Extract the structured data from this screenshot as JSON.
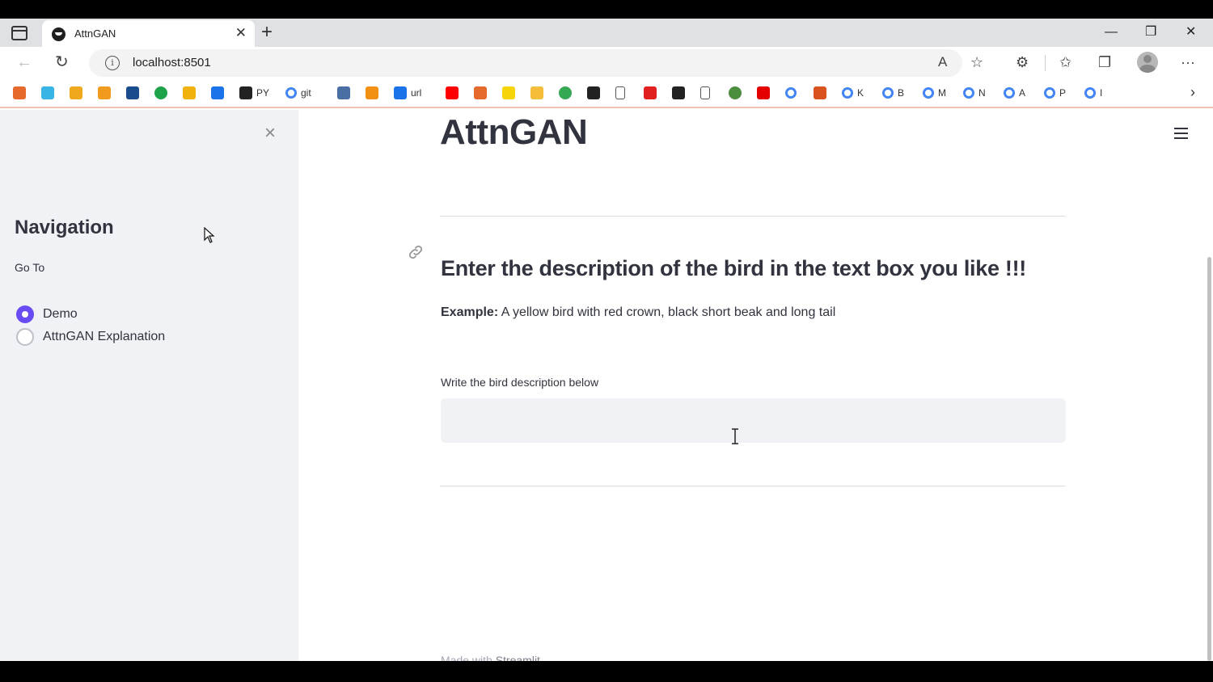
{
  "browser": {
    "tab_title": "AttnGAN",
    "tab_close": "✕",
    "new_tab": "+",
    "window_controls": {
      "minimize": "—",
      "restore": "❐",
      "close": "✕"
    },
    "url": "localhost:8501",
    "bookmarks": [
      {
        "icon": "squares-icon",
        "color": "#e8692c",
        "text": ""
      },
      {
        "icon": "swirl-icon",
        "color": "#37b5e5",
        "text": ""
      },
      {
        "icon": "badge-icon",
        "color": "#f0a81e",
        "text": ""
      },
      {
        "icon": "bars-icon",
        "color": "#f09a1e",
        "text": ""
      },
      {
        "icon": "ieee-icon",
        "color": "#1a4b8c",
        "text": ""
      },
      {
        "icon": "green-circle-icon",
        "color": "#1fa34a",
        "text": ""
      },
      {
        "icon": "pencil-icon",
        "color": "#f2b20e",
        "text": ""
      },
      {
        "icon": "drive-icon",
        "color": "#1a73e8",
        "text": ""
      },
      {
        "icon": "github-icon",
        "color": "#222222",
        "text": "PY"
      },
      {
        "icon": "google-icon",
        "color": "#4285f4",
        "text": "git"
      },
      {
        "icon": "layers-icon",
        "color": "#4a6fa5",
        "text": ""
      },
      {
        "icon": "pma-icon",
        "color": "#f29111",
        "text": ""
      },
      {
        "icon": "arc-icon",
        "color": "#1a73e8",
        "text": "url"
      },
      {
        "icon": "youtube-icon",
        "color": "#ff0000",
        "text": ""
      },
      {
        "icon": "flower-icon",
        "color": "#e56a2b",
        "text": ""
      },
      {
        "icon": "p-icon",
        "color": "#f7d40a",
        "text": ""
      },
      {
        "icon": "folder-icon",
        "color": "#f4bd3a",
        "text": ""
      },
      {
        "icon": "ring-icon",
        "color": "#34a853",
        "text": ""
      },
      {
        "icon": "arrow-icon",
        "color": "#222222",
        "text": ""
      },
      {
        "icon": "page-icon",
        "color": "#555555",
        "text": ""
      },
      {
        "icon": "heart-icon",
        "color": "#e02020",
        "text": ""
      },
      {
        "icon": "dl-icon",
        "color": "#222222",
        "text": ""
      },
      {
        "icon": "page-icon",
        "color": "#555555",
        "text": ""
      },
      {
        "icon": "globe-icon",
        "color": "#4b8e3e",
        "text": ""
      },
      {
        "icon": "airtel-icon",
        "color": "#e40000",
        "text": ""
      },
      {
        "icon": "google-icon",
        "color": "#4285f4",
        "text": ""
      },
      {
        "icon": "matlab-icon",
        "color": "#d9531e",
        "text": ""
      },
      {
        "icon": "google-icon",
        "color": "#4285f4",
        "text": "K"
      },
      {
        "icon": "google-icon",
        "color": "#4285f4",
        "text": "B"
      },
      {
        "icon": "google-icon",
        "color": "#4285f4",
        "text": "M"
      },
      {
        "icon": "google-icon",
        "color": "#4285f4",
        "text": "N"
      },
      {
        "icon": "google-icon",
        "color": "#4285f4",
        "text": "A"
      },
      {
        "icon": "google-icon",
        "color": "#4285f4",
        "text": "P"
      },
      {
        "icon": "google-icon",
        "color": "#4285f4",
        "text": "I"
      }
    ]
  },
  "sidebar": {
    "close": "×",
    "title": "Navigation",
    "goto_label": "Go To",
    "options": [
      {
        "label": "Demo",
        "checked": true
      },
      {
        "label": "AttnGAN Explanation",
        "checked": false
      }
    ]
  },
  "main": {
    "title": "AttnGAN",
    "subheading": "Enter the description of the bird in the text box you like !!!",
    "example_label": "Example:",
    "example_text": " A yellow bird with red crown, black short beak and long tail",
    "input_label": "Write the bird description below",
    "input_value": "",
    "footer_prefix": "Made with ",
    "footer_link": "Streamlit"
  },
  "colors": {
    "accent": "#6a4cf5",
    "sidebar_bg": "#f0f2f6",
    "text": "#31333f"
  }
}
